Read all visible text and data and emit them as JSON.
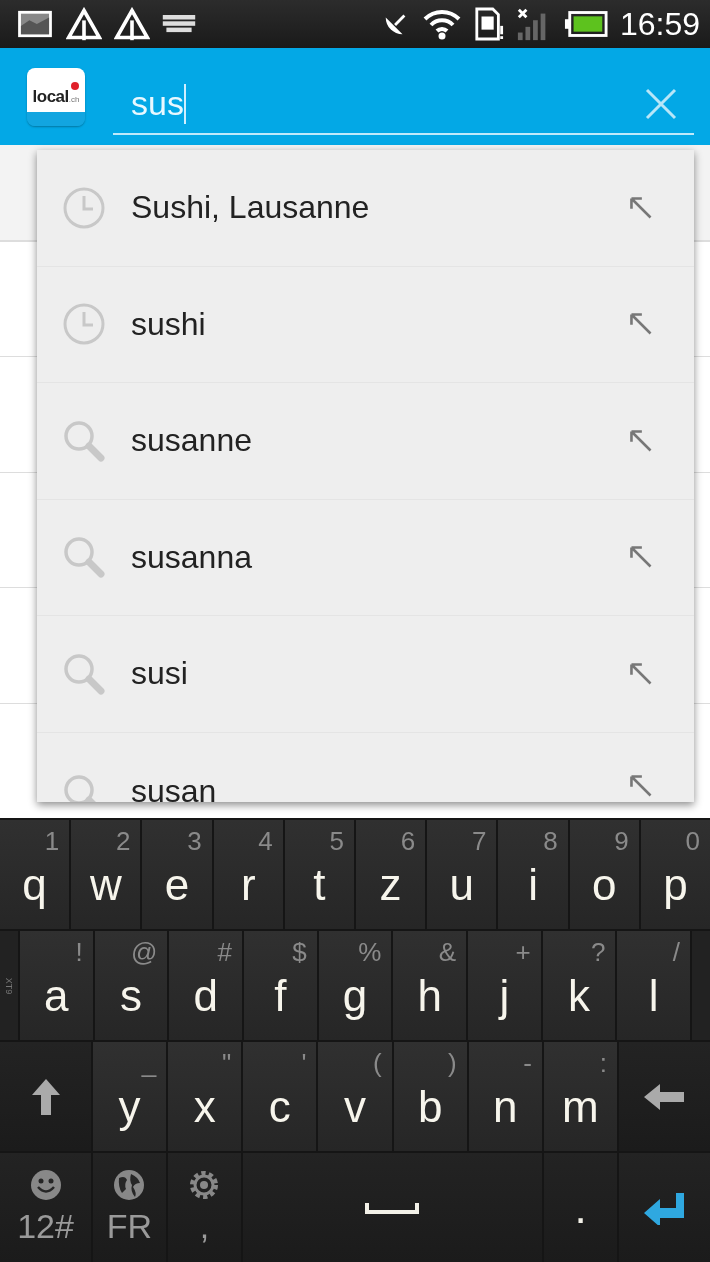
{
  "status_bar": {
    "time": "16:59"
  },
  "header": {
    "logo": {
      "text": "local",
      "suffix": ".ch"
    },
    "search": {
      "value": "sus"
    }
  },
  "suggestions": [
    {
      "text": "Sushi, Lausanne",
      "kind": "history"
    },
    {
      "text": "sushi",
      "kind": "history"
    },
    {
      "text": "susanne",
      "kind": "search"
    },
    {
      "text": "susanna",
      "kind": "search"
    },
    {
      "text": "susi",
      "kind": "search"
    },
    {
      "text": "susan",
      "kind": "search"
    }
  ],
  "keyboard": {
    "mode_label": "XT9",
    "rows": [
      {
        "keys": [
          {
            "kind": "letter",
            "main": "q",
            "alt": "1"
          },
          {
            "kind": "letter",
            "main": "w",
            "alt": "2"
          },
          {
            "kind": "letter",
            "main": "e",
            "alt": "3"
          },
          {
            "kind": "letter",
            "main": "r",
            "alt": "4"
          },
          {
            "kind": "letter",
            "main": "t",
            "alt": "5"
          },
          {
            "kind": "letter",
            "main": "z",
            "alt": "6"
          },
          {
            "kind": "letter",
            "main": "u",
            "alt": "7"
          },
          {
            "kind": "letter",
            "main": "i",
            "alt": "8"
          },
          {
            "kind": "letter",
            "main": "o",
            "alt": "9"
          },
          {
            "kind": "letter",
            "main": "p",
            "alt": "0"
          }
        ]
      },
      {
        "keys": [
          {
            "kind": "letter",
            "main": "a",
            "alt": "!"
          },
          {
            "kind": "letter",
            "main": "s",
            "alt": "@"
          },
          {
            "kind": "letter",
            "main": "d",
            "alt": "#"
          },
          {
            "kind": "letter",
            "main": "f",
            "alt": "$"
          },
          {
            "kind": "letter",
            "main": "g",
            "alt": "%"
          },
          {
            "kind": "letter",
            "main": "h",
            "alt": "&"
          },
          {
            "kind": "letter",
            "main": "j",
            "alt": "+"
          },
          {
            "kind": "letter",
            "main": "k",
            "alt": "?"
          },
          {
            "kind": "letter",
            "main": "l",
            "alt": "/"
          }
        ]
      },
      {
        "keys": [
          {
            "kind": "shift"
          },
          {
            "kind": "letter",
            "main": "y",
            "alt": "_"
          },
          {
            "kind": "letter",
            "main": "x",
            "alt": "\""
          },
          {
            "kind": "letter",
            "main": "c",
            "alt": "'"
          },
          {
            "kind": "letter",
            "main": "v",
            "alt": "("
          },
          {
            "kind": "letter",
            "main": "b",
            "alt": ")"
          },
          {
            "kind": "letter",
            "main": "n",
            "alt": "-"
          },
          {
            "kind": "letter",
            "main": "m",
            "alt": ":"
          },
          {
            "kind": "backspace"
          }
        ]
      },
      {
        "keys": [
          {
            "kind": "emoji",
            "main": "12#"
          },
          {
            "kind": "language",
            "main": "FR"
          },
          {
            "kind": "settings",
            "main": ","
          },
          {
            "kind": "space"
          },
          {
            "kind": "period",
            "main": "."
          },
          {
            "kind": "enter"
          }
        ]
      }
    ]
  }
}
